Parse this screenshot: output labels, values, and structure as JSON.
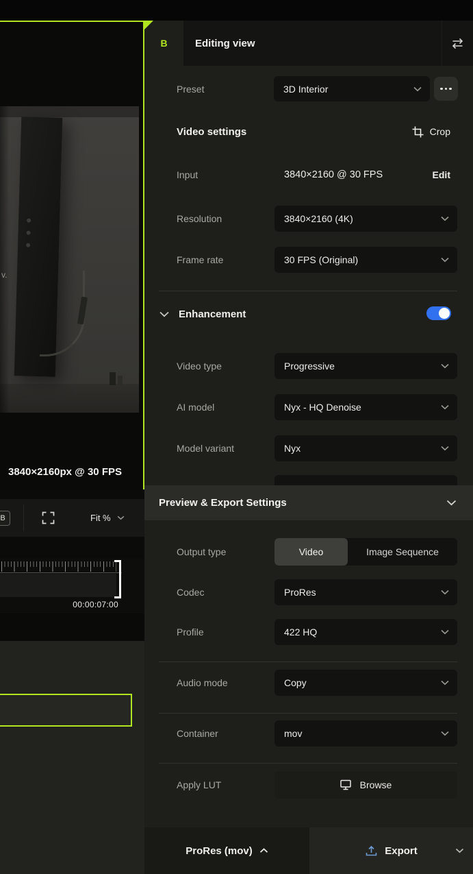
{
  "colors": {
    "accent": "#b0e51f",
    "toggle_on": "#3170ee",
    "export_icon": "#6d9bd3"
  },
  "left": {
    "overlay_fragment": "v.",
    "preview_resolution": "3840×2160px @ 30 FPS",
    "compare_badge": "B",
    "fit_label": "Fit %",
    "timecode": "00:00:07:00"
  },
  "tabbar": {
    "tab_badge": "B",
    "title": "Editing view"
  },
  "preset": {
    "label": "Preset",
    "value": "3D Interior"
  },
  "video_settings": {
    "title": "Video settings",
    "crop_label": "Crop",
    "input": {
      "label": "Input",
      "value": "3840×2160 @ 30 FPS",
      "edit_label": "Edit"
    },
    "resolution": {
      "label": "Resolution",
      "value": "3840×2160 (4K)"
    },
    "frame_rate": {
      "label": "Frame rate",
      "value": "30 FPS (Original)"
    }
  },
  "enhancement": {
    "title": "Enhancement",
    "video_type": {
      "label": "Video type",
      "value": "Progressive"
    },
    "ai_model": {
      "label": "AI model",
      "value": "Nyx - HQ Denoise"
    },
    "model_variant": {
      "label": "Model variant",
      "value": "Nyx"
    }
  },
  "export_section": {
    "title": "Preview & Export Settings",
    "output_type": {
      "label": "Output type",
      "options": [
        "Video",
        "Image Sequence"
      ],
      "selected": "Video"
    },
    "codec": {
      "label": "Codec",
      "value": "ProRes"
    },
    "profile": {
      "label": "Profile",
      "value": "422 HQ"
    },
    "audio_mode": {
      "label": "Audio mode",
      "value": "Copy"
    },
    "container": {
      "label": "Container",
      "value": "mov"
    },
    "apply_lut": {
      "label": "Apply LUT",
      "browse_label": "Browse"
    }
  },
  "bottom_bar": {
    "summary": "ProRes (mov)",
    "export_label": "Export"
  }
}
